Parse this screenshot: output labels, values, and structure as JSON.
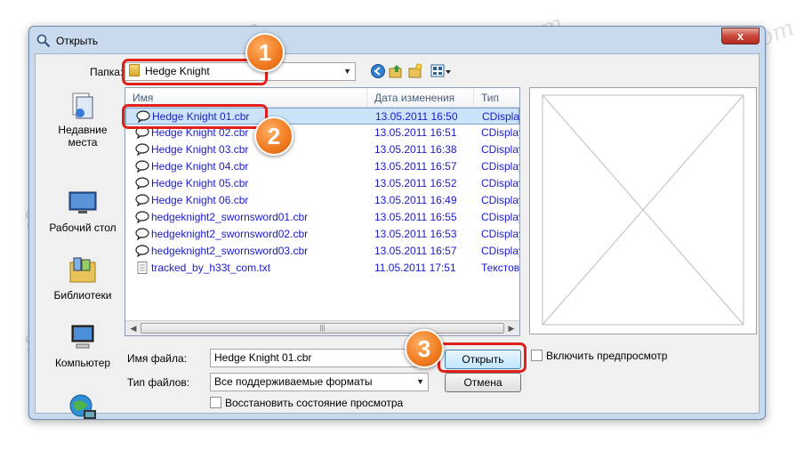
{
  "window": {
    "title": "Открыть",
    "close_label": "x"
  },
  "toolbar": {
    "folder_label": "Папка:",
    "folder_value": "Hedge Knight"
  },
  "places": [
    {
      "label": "Недавние места"
    },
    {
      "label": "Рабочий стол"
    },
    {
      "label": "Библиотеки"
    },
    {
      "label": "Компьютер"
    }
  ],
  "filelist": {
    "columns": [
      "Имя",
      "Дата изменения",
      "Тип"
    ],
    "rows": [
      {
        "name": "Hedge Knight 01.cbr",
        "date": "13.05.2011 16:50",
        "type": "CDisplay F"
      },
      {
        "name": "Hedge Knight 02.cbr",
        "date": "13.05.2011 16:51",
        "type": "CDisplay F"
      },
      {
        "name": "Hedge Knight 03.cbr",
        "date": "13.05.2011 16:38",
        "type": "CDisplay F"
      },
      {
        "name": "Hedge Knight 04.cbr",
        "date": "13.05.2011 16:57",
        "type": "CDisplay F"
      },
      {
        "name": "Hedge Knight 05.cbr",
        "date": "13.05.2011 16:52",
        "type": "CDisplay F"
      },
      {
        "name": "Hedge Knight 06.cbr",
        "date": "13.05.2011 16:49",
        "type": "CDisplay F"
      },
      {
        "name": "hedgeknight2_swornsword01.cbr",
        "date": "13.05.2011 16:55",
        "type": "CDisplay F"
      },
      {
        "name": "hedgeknight2_swornsword02.cbr",
        "date": "13.05.2011 16:53",
        "type": "CDisplay F"
      },
      {
        "name": "hedgeknight2_swornsword03.cbr",
        "date": "13.05.2011 16:57",
        "type": "CDisplay F"
      },
      {
        "name": "tracked_by_h33t_com.txt",
        "date": "11.05.2011 17:51",
        "type": "Текстовы"
      }
    ]
  },
  "bottom": {
    "filename_label": "Имя файла:",
    "filename_value": "Hedge Knight 01.cbr",
    "filetype_label": "Тип файлов:",
    "filetype_value": "Все поддерживаемые форматы",
    "open_label": "Открыть",
    "cancel_label": "Отмена",
    "preview_label": "Включить предпросмотр",
    "restore_label": "Восстановить состояние просмотра"
  },
  "badges": [
    "1",
    "2",
    "3"
  ],
  "watermark": "Soringpcrepair.com",
  "colors": {
    "highlight": "#e0201a",
    "badge": "#f07a1f",
    "link": "#1a1ac8"
  }
}
